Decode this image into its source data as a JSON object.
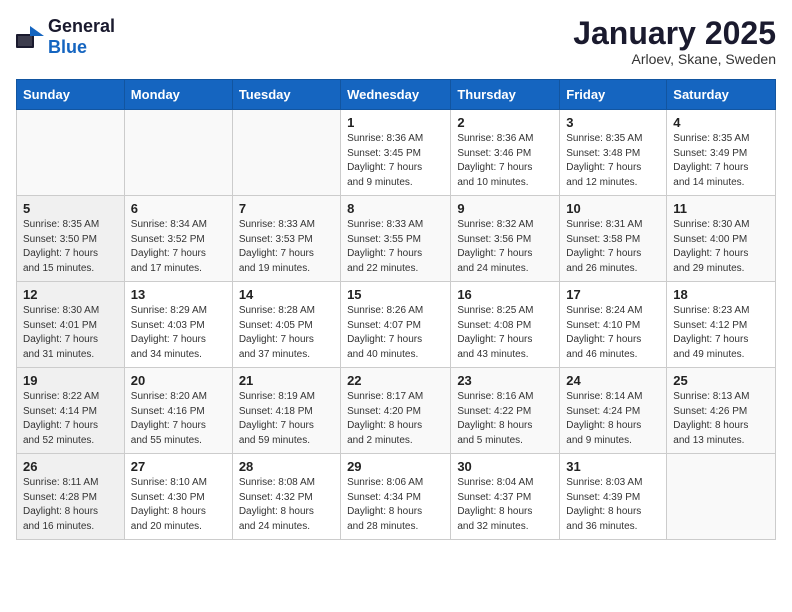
{
  "header": {
    "logo_general": "General",
    "logo_blue": "Blue",
    "title": "January 2025",
    "subtitle": "Arloev, Skane, Sweden"
  },
  "weekdays": [
    "Sunday",
    "Monday",
    "Tuesday",
    "Wednesday",
    "Thursday",
    "Friday",
    "Saturday"
  ],
  "weeks": [
    [
      {
        "day": "",
        "info": ""
      },
      {
        "day": "",
        "info": ""
      },
      {
        "day": "",
        "info": ""
      },
      {
        "day": "1",
        "info": "Sunrise: 8:36 AM\nSunset: 3:45 PM\nDaylight: 7 hours\nand 9 minutes."
      },
      {
        "day": "2",
        "info": "Sunrise: 8:36 AM\nSunset: 3:46 PM\nDaylight: 7 hours\nand 10 minutes."
      },
      {
        "day": "3",
        "info": "Sunrise: 8:35 AM\nSunset: 3:48 PM\nDaylight: 7 hours\nand 12 minutes."
      },
      {
        "day": "4",
        "info": "Sunrise: 8:35 AM\nSunset: 3:49 PM\nDaylight: 7 hours\nand 14 minutes."
      }
    ],
    [
      {
        "day": "5",
        "info": "Sunrise: 8:35 AM\nSunset: 3:50 PM\nDaylight: 7 hours\nand 15 minutes."
      },
      {
        "day": "6",
        "info": "Sunrise: 8:34 AM\nSunset: 3:52 PM\nDaylight: 7 hours\nand 17 minutes."
      },
      {
        "day": "7",
        "info": "Sunrise: 8:33 AM\nSunset: 3:53 PM\nDaylight: 7 hours\nand 19 minutes."
      },
      {
        "day": "8",
        "info": "Sunrise: 8:33 AM\nSunset: 3:55 PM\nDaylight: 7 hours\nand 22 minutes."
      },
      {
        "day": "9",
        "info": "Sunrise: 8:32 AM\nSunset: 3:56 PM\nDaylight: 7 hours\nand 24 minutes."
      },
      {
        "day": "10",
        "info": "Sunrise: 8:31 AM\nSunset: 3:58 PM\nDaylight: 7 hours\nand 26 minutes."
      },
      {
        "day": "11",
        "info": "Sunrise: 8:30 AM\nSunset: 4:00 PM\nDaylight: 7 hours\nand 29 minutes."
      }
    ],
    [
      {
        "day": "12",
        "info": "Sunrise: 8:30 AM\nSunset: 4:01 PM\nDaylight: 7 hours\nand 31 minutes."
      },
      {
        "day": "13",
        "info": "Sunrise: 8:29 AM\nSunset: 4:03 PM\nDaylight: 7 hours\nand 34 minutes."
      },
      {
        "day": "14",
        "info": "Sunrise: 8:28 AM\nSunset: 4:05 PM\nDaylight: 7 hours\nand 37 minutes."
      },
      {
        "day": "15",
        "info": "Sunrise: 8:26 AM\nSunset: 4:07 PM\nDaylight: 7 hours\nand 40 minutes."
      },
      {
        "day": "16",
        "info": "Sunrise: 8:25 AM\nSunset: 4:08 PM\nDaylight: 7 hours\nand 43 minutes."
      },
      {
        "day": "17",
        "info": "Sunrise: 8:24 AM\nSunset: 4:10 PM\nDaylight: 7 hours\nand 46 minutes."
      },
      {
        "day": "18",
        "info": "Sunrise: 8:23 AM\nSunset: 4:12 PM\nDaylight: 7 hours\nand 49 minutes."
      }
    ],
    [
      {
        "day": "19",
        "info": "Sunrise: 8:22 AM\nSunset: 4:14 PM\nDaylight: 7 hours\nand 52 minutes."
      },
      {
        "day": "20",
        "info": "Sunrise: 8:20 AM\nSunset: 4:16 PM\nDaylight: 7 hours\nand 55 minutes."
      },
      {
        "day": "21",
        "info": "Sunrise: 8:19 AM\nSunset: 4:18 PM\nDaylight: 7 hours\nand 59 minutes."
      },
      {
        "day": "22",
        "info": "Sunrise: 8:17 AM\nSunset: 4:20 PM\nDaylight: 8 hours\nand 2 minutes."
      },
      {
        "day": "23",
        "info": "Sunrise: 8:16 AM\nSunset: 4:22 PM\nDaylight: 8 hours\nand 5 minutes."
      },
      {
        "day": "24",
        "info": "Sunrise: 8:14 AM\nSunset: 4:24 PM\nDaylight: 8 hours\nand 9 minutes."
      },
      {
        "day": "25",
        "info": "Sunrise: 8:13 AM\nSunset: 4:26 PM\nDaylight: 8 hours\nand 13 minutes."
      }
    ],
    [
      {
        "day": "26",
        "info": "Sunrise: 8:11 AM\nSunset: 4:28 PM\nDaylight: 8 hours\nand 16 minutes."
      },
      {
        "day": "27",
        "info": "Sunrise: 8:10 AM\nSunset: 4:30 PM\nDaylight: 8 hours\nand 20 minutes."
      },
      {
        "day": "28",
        "info": "Sunrise: 8:08 AM\nSunset: 4:32 PM\nDaylight: 8 hours\nand 24 minutes."
      },
      {
        "day": "29",
        "info": "Sunrise: 8:06 AM\nSunset: 4:34 PM\nDaylight: 8 hours\nand 28 minutes."
      },
      {
        "day": "30",
        "info": "Sunrise: 8:04 AM\nSunset: 4:37 PM\nDaylight: 8 hours\nand 32 minutes."
      },
      {
        "day": "31",
        "info": "Sunrise: 8:03 AM\nSunset: 4:39 PM\nDaylight: 8 hours\nand 36 minutes."
      },
      {
        "day": "",
        "info": ""
      }
    ]
  ]
}
